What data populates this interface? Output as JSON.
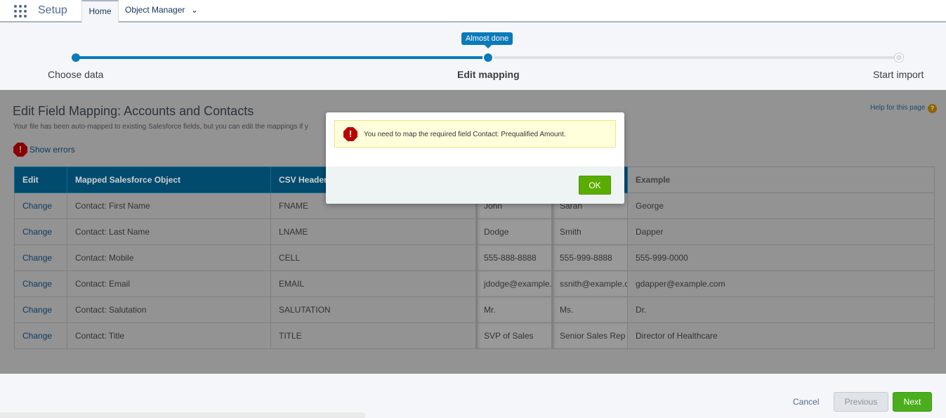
{
  "header": {
    "app_name": "Setup",
    "tabs": [
      {
        "label": "Home"
      },
      {
        "label": "Object Manager"
      }
    ]
  },
  "stepper": {
    "steps": [
      "Choose data",
      "Edit mapping",
      "Start import"
    ],
    "current": "Edit mapping",
    "tooltip": "Almost done",
    "progress_percent": 50
  },
  "page": {
    "title": "Edit Field Mapping: Accounts and Contacts",
    "subtitle": "Your file has been auto-mapped to existing Salesforce fields, but you can edit the mappings if y",
    "help": "Help for this page",
    "show_errors": "Show errors"
  },
  "table": {
    "headers": [
      "Edit",
      "Mapped Salesforce Object",
      "CSV Header",
      "",
      "",
      "Example"
    ],
    "rows": [
      [
        "Change",
        "Contact: First Name",
        "FNAME",
        "John",
        "Sarah",
        "George"
      ],
      [
        "Change",
        "Contact: Last Name",
        "LNAME",
        "Dodge",
        "Smith",
        "Dapper"
      ],
      [
        "Change",
        "Contact: Mobile",
        "CELL",
        "555-888-8888",
        "555-999-8888",
        "555-999-0000"
      ],
      [
        "Change",
        "Contact: Email",
        "EMAIL",
        "jdodge@example.c",
        "ssnith@example.c",
        "gdapper@example.com"
      ],
      [
        "Change",
        "Contact: Salutation",
        "SALUTATION",
        "Mr.",
        "Ms.",
        "Dr."
      ],
      [
        "Change",
        "Contact: Title",
        "TITLE",
        "SVP of Sales",
        "Senior Sales Rep",
        "Director of Healthcare"
      ]
    ]
  },
  "modal": {
    "message": "You need to map the required field Contact: Prequalified Amount.",
    "ok": "OK"
  },
  "footer": {
    "cancel": "Cancel",
    "previous": "Previous",
    "next": "Next"
  },
  "colors": {
    "accent": "#0070d2",
    "ok_green": "#5aad00",
    "error": "#c23934"
  }
}
